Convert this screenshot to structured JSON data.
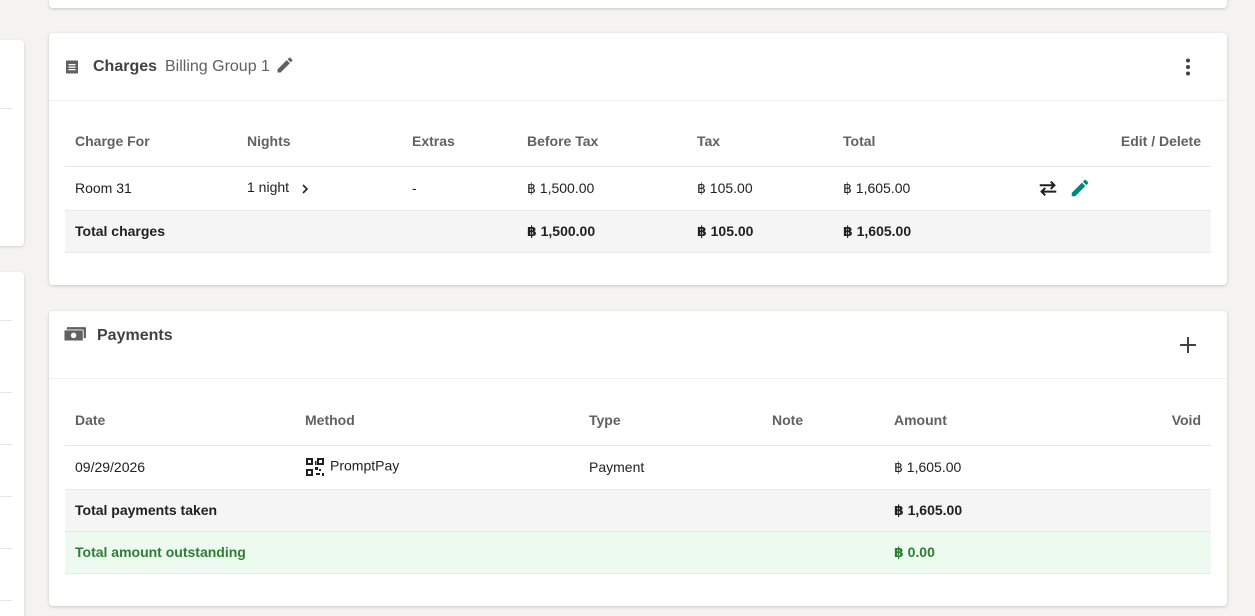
{
  "charges": {
    "title": "Charges",
    "group": "Billing Group 1",
    "columns": [
      "Charge For",
      "Nights",
      "Extras",
      "Before Tax",
      "Tax",
      "Total",
      "Edit / Delete"
    ],
    "row": {
      "charge_for": "Room 31",
      "nights": "1 night",
      "extras": "-",
      "before_tax": "฿ 1,500.00",
      "tax": "฿ 105.00",
      "total": "฿ 1,605.00"
    },
    "totals": {
      "label": "Total charges",
      "before_tax": "฿ 1,500.00",
      "tax": "฿ 105.00",
      "total": "฿ 1,605.00"
    }
  },
  "payments": {
    "title": "Payments",
    "columns": [
      "Date",
      "Method",
      "Type",
      "Note",
      "Amount",
      "Void"
    ],
    "row": {
      "date": "09/29/2026",
      "method": "PromptPay",
      "type": "Payment",
      "note": "",
      "amount": "฿ 1,605.00"
    },
    "total_taken": {
      "label": "Total payments taken",
      "amount": "฿ 1,605.00"
    },
    "outstanding": {
      "label": "Total amount outstanding",
      "amount": "฿ 0.00"
    }
  },
  "colors": {
    "accent": "#00897b",
    "outstanding": "#2e7d32"
  },
  "icons": {
    "charges": "receipt-icon",
    "edit_group": "pencil-icon",
    "menu": "more-vert-icon",
    "payments": "cash-icon",
    "add": "plus-icon",
    "transfer": "swap-icon",
    "edit_row": "pencil-icon",
    "method": "qr-code-icon",
    "expand": "chevron-right-icon"
  }
}
